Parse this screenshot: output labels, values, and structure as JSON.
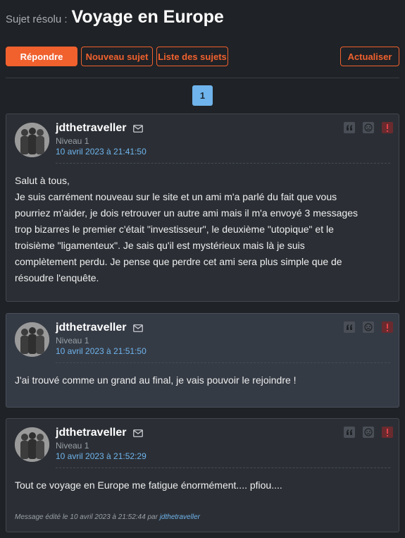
{
  "header": {
    "prefix": "Sujet résolu :",
    "title": "Voyage en Europe"
  },
  "toolbar": {
    "reply": "Répondre",
    "new_topic": "Nouveau sujet",
    "topic_list": "Liste des sujets",
    "refresh": "Actualiser"
  },
  "pagination": {
    "current": "1"
  },
  "colors": {
    "accent": "#f0612e",
    "link": "#6fb4ec",
    "background": "#1f2226",
    "post_bg": "#2b2f35",
    "post_alt_bg": "#353b45"
  },
  "icons": {
    "mail": "envelope-icon",
    "quote": "quote-icon",
    "dislike": "sad-face-icon",
    "alert": "exclamation-icon"
  },
  "posts": [
    {
      "author": "jdthetraveller",
      "level": "Niveau 1",
      "date": "10 avril 2023 à 21:41:50",
      "lines": [
        "Salut à tous,",
        "Je suis carrément nouveau sur le site et un ami m'a parlé du fait que vous",
        "pourriez m'aider, je dois retrouver un autre ami mais il m'a envoyé 3 messages",
        "trop bizarres le premier c'était \"investisseur\", le deuxième \"utopique\" et le",
        "troisième \"ligamenteux\". Je sais qu'il est mystérieux mais là je suis",
        "complètement perdu. Je pense que perdre cet ami sera plus simple que de",
        "résoudre l'enquête."
      ]
    },
    {
      "author": "jdthetraveller",
      "level": "Niveau 1",
      "date": "10 avril 2023 à 21:51:50",
      "lines": [
        "J'ai trouvé comme un grand au final, je vais pouvoir le rejoindre !"
      ]
    },
    {
      "author": "jdthetraveller",
      "level": "Niveau 1",
      "date": "10 avril 2023 à 21:52:29",
      "lines": [
        "Tout ce voyage en Europe me fatigue énormément.... pfiou...."
      ],
      "edit_prefix": "Message édité le 10 avril 2023 à 21:52:44 par",
      "edit_by": "jdthetraveller"
    }
  ]
}
